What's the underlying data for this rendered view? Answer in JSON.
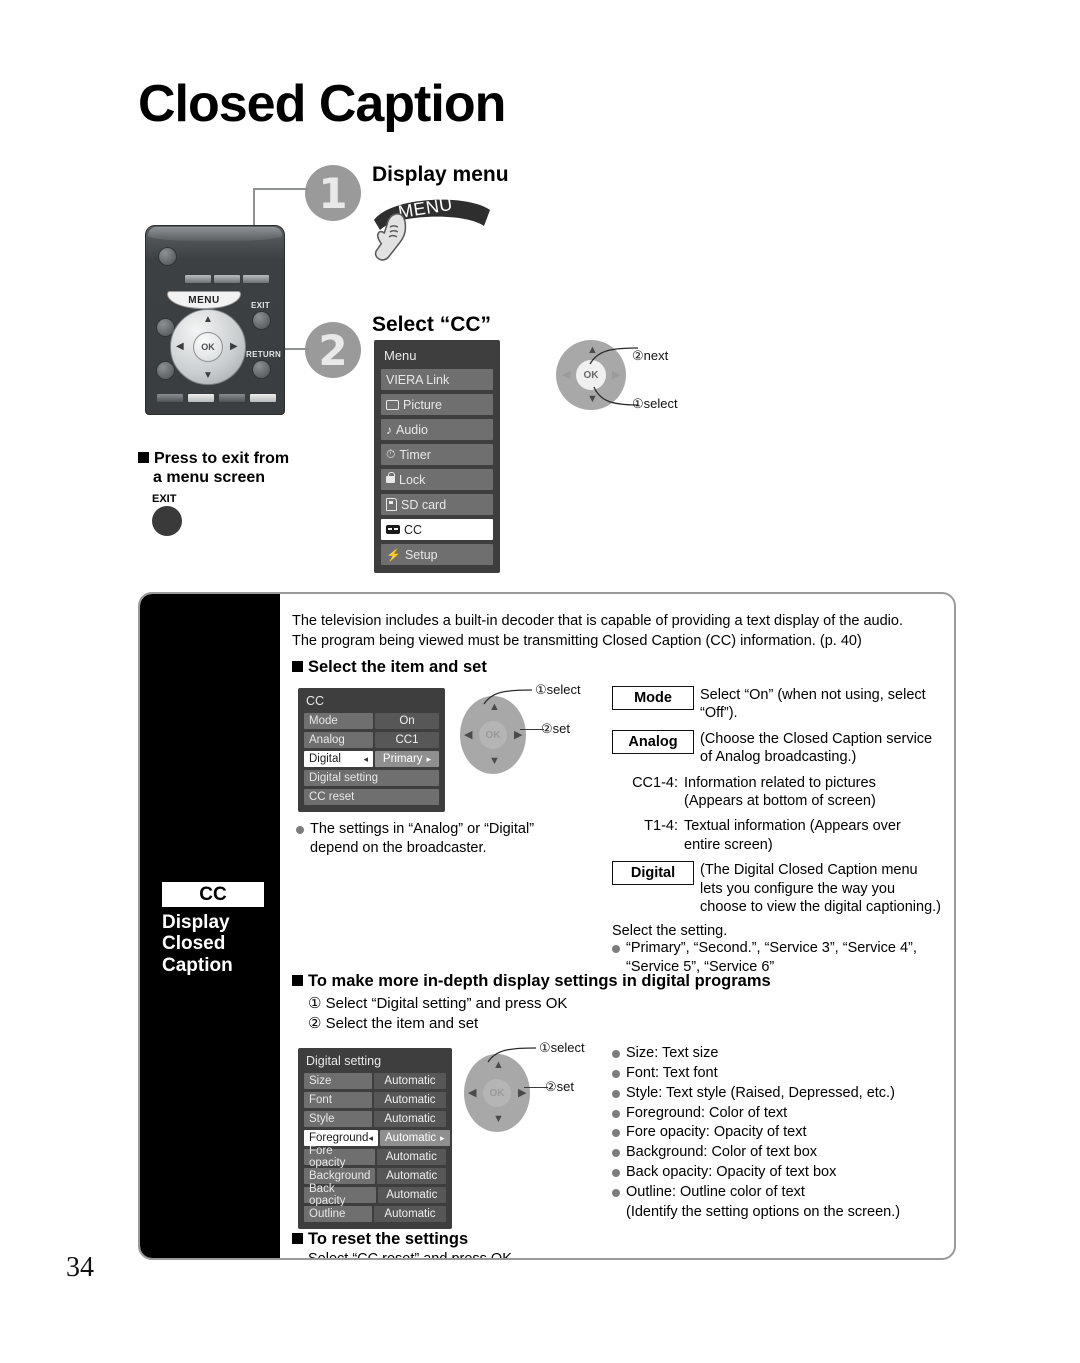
{
  "page_title": "Closed Caption",
  "page_number": "34",
  "steps": [
    {
      "num": "1",
      "title": "Display menu",
      "button_label": "MENU"
    },
    {
      "num": "2",
      "title": "Select “CC”"
    }
  ],
  "remote": {
    "menu_button_label": "MENU",
    "exit_button_label": "EXIT",
    "return_button_label": "RETURN",
    "ok_label": "OK"
  },
  "exit_note": {
    "heading_line1": "Press to exit from",
    "heading_line2": "a menu screen",
    "button_label": "EXIT"
  },
  "tv_menu": {
    "title": "Menu",
    "items": [
      {
        "label": "VIERA Link",
        "icon": "none",
        "selected": false
      },
      {
        "label": "Picture",
        "icon": "picture-icon",
        "selected": false
      },
      {
        "label": "Audio",
        "icon": "music-note-icon",
        "selected": false
      },
      {
        "label": "Timer",
        "icon": "clock-icon",
        "selected": false
      },
      {
        "label": "Lock",
        "icon": "lock-icon",
        "selected": false
      },
      {
        "label": "SD card",
        "icon": "sd-card-icon",
        "selected": false
      },
      {
        "label": "CC",
        "icon": "cc-icon",
        "selected": true
      },
      {
        "label": "Setup",
        "icon": "lightning-icon",
        "selected": false
      }
    ]
  },
  "nav_wheel_top": {
    "ok_label": "OK",
    "labels": [
      {
        "text": "②next"
      },
      {
        "text": "①select"
      }
    ]
  },
  "nav_wheel_cc": {
    "ok_label": "OK",
    "labels": [
      {
        "text": "①select"
      },
      {
        "text": "②set"
      }
    ]
  },
  "nav_wheel_digital": {
    "ok_label": "OK",
    "labels": [
      {
        "text": "①select"
      },
      {
        "text": "②set"
      }
    ]
  },
  "sidebar_tab": {
    "badge": "CC",
    "line1": "Display",
    "line2": "Closed",
    "line3": "Caption"
  },
  "intro": {
    "line1": "The television includes a built-in decoder that is capable of providing a text display of the audio.",
    "line2": "The program being viewed must be transmitting Closed Caption (CC) information. (p. 40)"
  },
  "section_select": {
    "heading": "Select the item and set",
    "note": "The settings in “Analog” or “Digital” depend on the broadcaster."
  },
  "cc_osd": {
    "title": "CC",
    "rows": [
      {
        "key": "Mode",
        "value": "On",
        "selected": false
      },
      {
        "key": "Analog",
        "value": "CC1",
        "selected": false
      },
      {
        "key": "Digital",
        "value": "Primary",
        "selected": true
      },
      {
        "key": "Digital setting",
        "value": "",
        "selected": false
      },
      {
        "key": "CC reset",
        "value": "",
        "selected": false
      }
    ]
  },
  "definitions": [
    {
      "key": "Mode",
      "boxed": true,
      "value": "Select “On” (when not using, select “Off”)."
    },
    {
      "key": "Analog",
      "boxed": true,
      "value": "(Choose the Closed Caption service of Analog broadcasting.)"
    },
    {
      "key": "CC1-4:",
      "boxed": false,
      "value": "Information related to pictures (Appears at bottom of screen)"
    },
    {
      "key": "T1-4:",
      "boxed": false,
      "value": "Textual information (Appears over entire screen)"
    },
    {
      "key": "Digital",
      "boxed": true,
      "value": "(The Digital Closed Caption menu lets you configure the way you choose to view the digital captioning.)"
    }
  ],
  "digital_note": {
    "line": "Select the setting.",
    "bullet": "“Primary”, “Second.”, “Service 3”, “Service 4”, “Service 5”, “Service 6”"
  },
  "section_indepth": {
    "heading": "To make more in-depth display settings in digital programs",
    "step1": "① Select “Digital setting” and press OK",
    "step2": "② Select the item and set"
  },
  "digital_osd": {
    "title": "Digital setting",
    "rows": [
      {
        "key": "Size",
        "value": "Automatic",
        "selected": false
      },
      {
        "key": "Font",
        "value": "Automatic",
        "selected": false
      },
      {
        "key": "Style",
        "value": "Automatic",
        "selected": false
      },
      {
        "key": "Foreground",
        "value": "Automatic",
        "selected": true
      },
      {
        "key": "Fore opacity",
        "value": "Automatic",
        "selected": false
      },
      {
        "key": "Background",
        "value": "Automatic",
        "selected": false
      },
      {
        "key": "Back opacity",
        "value": "Automatic",
        "selected": false
      },
      {
        "key": "Outline",
        "value": "Automatic",
        "selected": false
      }
    ]
  },
  "digital_bullets": [
    "Size:  Text size",
    "Font:  Text font",
    "Style:  Text style (Raised, Depressed, etc.)",
    "Foreground:  Color of text",
    "Fore opacity:  Opacity of text",
    "Background:  Color of text box",
    "Back opacity:  Opacity of text box",
    "Outline:  Outline color of text"
  ],
  "digital_bullets_tail": "(Identify the setting options on the screen.)",
  "section_reset": {
    "heading": "To reset the settings",
    "body": "Select “CC reset” and press OK"
  }
}
